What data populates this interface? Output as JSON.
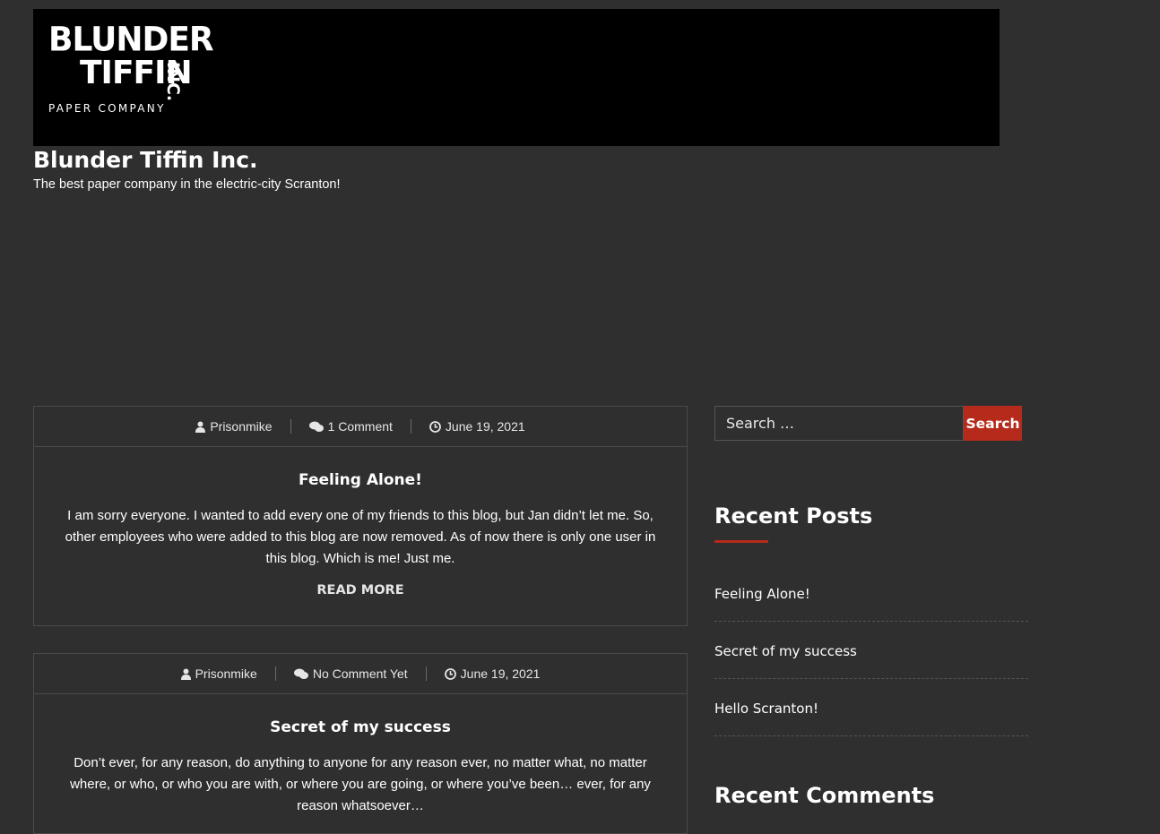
{
  "site": {
    "logo": {
      "line1": "BLUNDER",
      "line2": "TIFFIN",
      "suffix": "INC.",
      "line3": "PAPER COMPANY"
    },
    "title": "Blunder Tiffin Inc.",
    "tagline": "The best paper company in the electric-city Scranton!"
  },
  "posts": [
    {
      "author": "Prisonmike",
      "comments": "1 Comment",
      "date": "June 19, 2021",
      "title": "Feeling Alone!",
      "excerpt": "I am sorry everyone. I wanted to add every one of my friends to this blog, but Jan didn’t let me. So, other employees who were added to this blog are now removed. As of now there is only one user in this blog. Which is me! Just me.",
      "read_more": "Read More"
    },
    {
      "author": "Prisonmike",
      "comments": "No Comment Yet",
      "date": "June 19, 2021",
      "title": "Secret of my success",
      "excerpt": "Don’t ever, for any reason, do anything to anyone for any reason ever, no matter what, no matter where, or who, or who you are with, or where you are going, or where you’ve been… ever, for any reason whatsoever…"
    }
  ],
  "sidebar": {
    "search": {
      "placeholder": "Search …",
      "button": "Search"
    },
    "recent_posts": {
      "title": "Recent Posts",
      "items": [
        "Feeling Alone!",
        "Secret of my success",
        "Hello Scranton!"
      ]
    },
    "recent_comments": {
      "title": "Recent Comments"
    }
  },
  "colors": {
    "background": "#2f2f2f",
    "accent": "#b52a1a",
    "header": "#000000"
  }
}
